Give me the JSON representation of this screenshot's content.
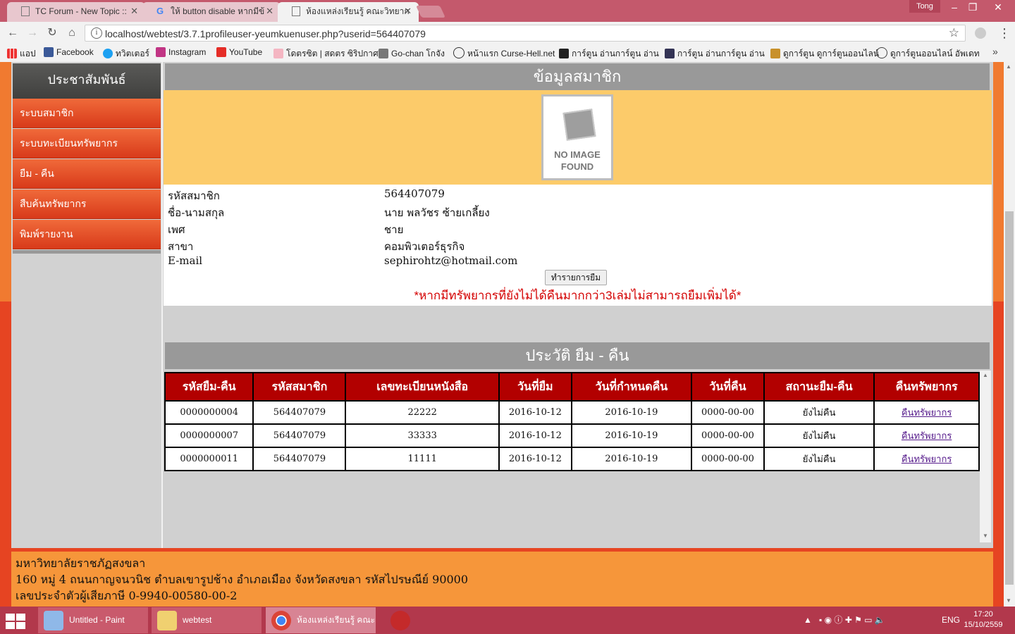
{
  "browser": {
    "tabs": [
      {
        "title": "TC Forum - New Topic :: "
      },
      {
        "title": "ให้ button disable หากมีข้"
      },
      {
        "title": "ห้องแหล่งเรียนรู้ คณะวิทยาก"
      }
    ],
    "user": "Tong",
    "url": "localhost/webtest/3.7.1profileuser-yeumkuenuser.php?userid=564407079",
    "bookmarks": [
      "แอป",
      "Facebook",
      "ทวิตเตอร์",
      "Instagram",
      "YouTube",
      "โดตรซิต | สดตร ซิริปกาศ",
      "Go-chan โกจัง",
      "หน้าแรก Curse-Hell.net",
      "การ์ตูน อ่านการ์ตูน อ่าน",
      "การ์ตูน อ่านการ์ตูน อ่าน",
      "ดูการ์ตูน ดูการ์ตูนออนไลน์",
      "ดูการ์ตูนออนไลน์ อัพเดท"
    ],
    "bookmarks_more": "»"
  },
  "sidebar": {
    "title": "ประชาสัมพันธ์",
    "items": [
      "ระบบสมาชิก",
      "ระบบทะเบียนทรัพยากร",
      "ยืม - คืน",
      "สืบค้นทรัพยากร",
      "พิมพ์รายงาน"
    ]
  },
  "member": {
    "section_title": "ข้อมูลสมาชิก",
    "no_image_text": "NO IMAGE FOUND",
    "fields": [
      {
        "label": "รหัสสมาชิก",
        "value": "564407079"
      },
      {
        "label": "ชื่อ-นามสกุล",
        "value": "นาย พลวัชร ซ้ายเกลี้ยง"
      },
      {
        "label": "เพศ",
        "value": "ชาย"
      },
      {
        "label": "สาขา",
        "value": "คอมพิวเตอร์ธุรกิจ"
      },
      {
        "label": "E-mail",
        "value": "sephirohtz@hotmail.com"
      }
    ],
    "borrow_button": "ทำรายการยืม",
    "warning": "*หากมีทรัพยากรที่ยังไม่ได้คืนมากกว่า3เล่มไม่สามารถยืมเพิ่มได้*"
  },
  "history": {
    "section_title": "ประวัติ ยืม - คืน",
    "columns": [
      "รหัสยืม-คืน",
      "รหัสสมาชิก",
      "เลขทะเบียนหนังสือ",
      "วันที่ยืม",
      "วันที่กำหนดคืน",
      "วันที่คืน",
      "สถานะยืม-คืน",
      "คืนทรัพยากร"
    ],
    "rows": [
      [
        "0000000004",
        "564407079",
        "22222",
        "2016-10-12",
        "2016-10-19",
        "0000-00-00",
        "ยังไม่คืน",
        "คืนทรัพยากร"
      ],
      [
        "0000000007",
        "564407079",
        "33333",
        "2016-10-12",
        "2016-10-19",
        "0000-00-00",
        "ยังไม่คืน",
        "คืนทรัพยากร"
      ],
      [
        "0000000011",
        "564407079",
        "11111",
        "2016-10-12",
        "2016-10-19",
        "0000-00-00",
        "ยังไม่คืน",
        "คืนทรัพยากร"
      ]
    ]
  },
  "footer": {
    "lines": [
      "มหาวิทยาลัยราชภัฏสงขลา",
      "160 หมู่ 4 ถนนกาญจนวนิช ตำบลเขารูปช้าง อำเภอเมือง จังหวัดสงขลา รหัสไปรษณีย์ 90000",
      "เลขประจำตัวผู้เสียภาษี 0-9940-00580-00-2"
    ]
  },
  "taskbar": {
    "items": [
      "Untitled - Paint",
      "webtest",
      "ห้องแหล่งเรียนรู้ คณะ..."
    ],
    "language": "ENG",
    "time": "17:20",
    "date": "15/10/2559"
  },
  "colors": {
    "accent_orange": "#f07a30",
    "table_header": "#b20000",
    "warning_red": "#d40000",
    "taskbar": "#b2384c"
  }
}
